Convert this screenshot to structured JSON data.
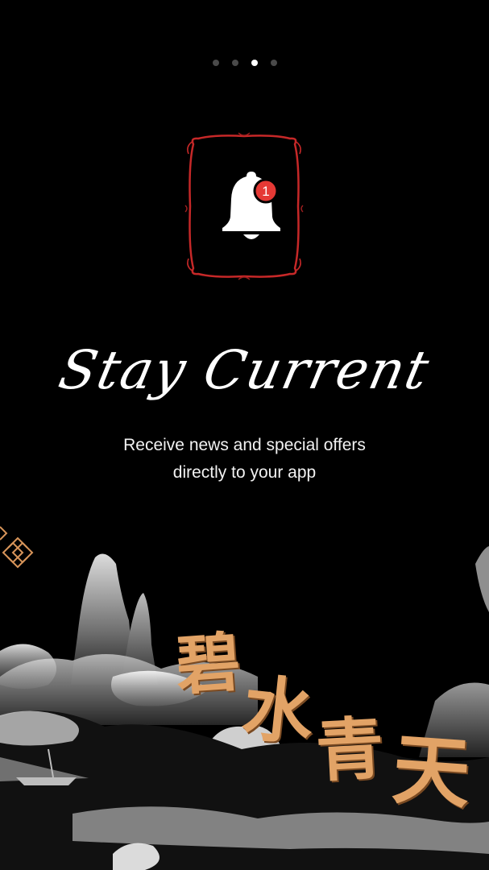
{
  "onboarding": {
    "pagination": {
      "total": 4,
      "current": 3
    },
    "icon": {
      "name": "bell-icon",
      "badge_count": "1",
      "badge_color": "#e53935",
      "frame_color": "#c62828"
    },
    "title": "Stay Current",
    "subtitle_line1": "Receive news and special offers",
    "subtitle_line2": "directly to your app"
  },
  "artwork": {
    "calligraphy": [
      "碧",
      "水",
      "青",
      "天"
    ],
    "calligraphy_color": "#e2a366"
  }
}
